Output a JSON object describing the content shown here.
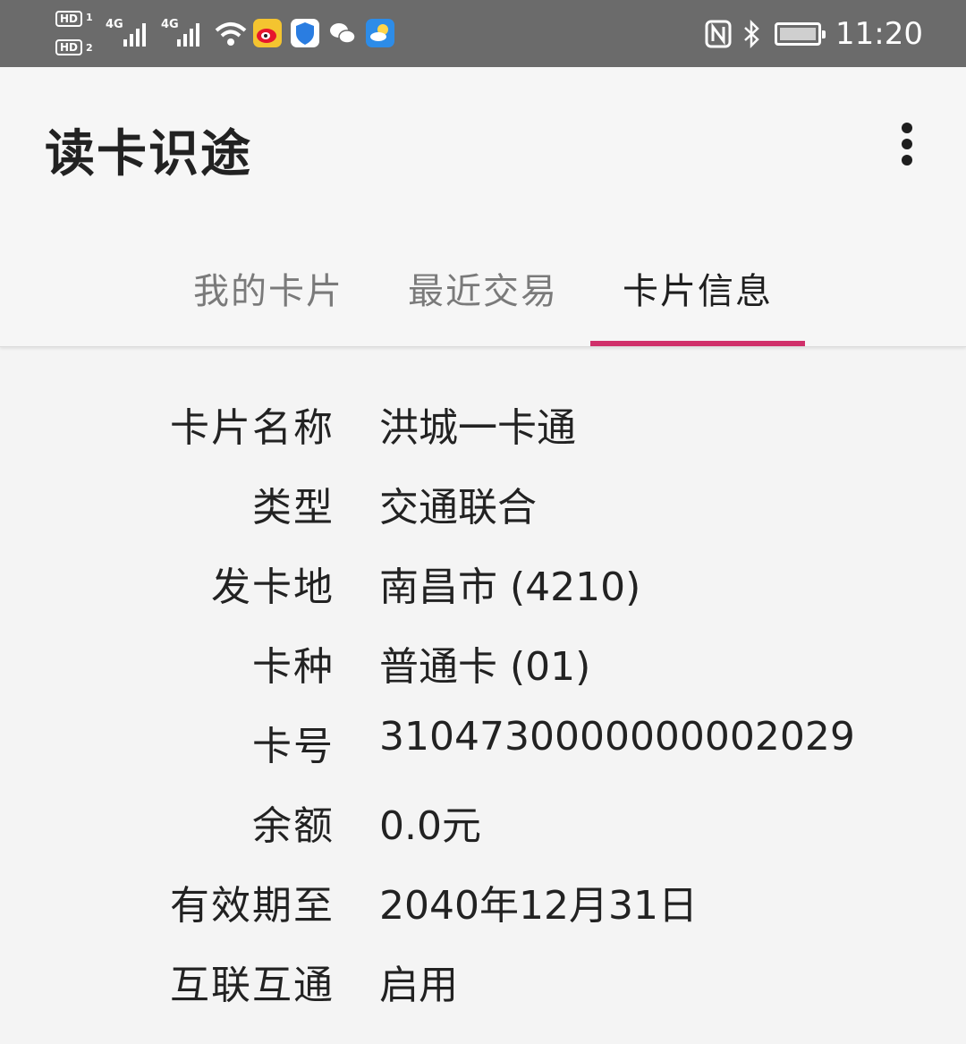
{
  "status_bar": {
    "hd1": "HD",
    "sim1": "1",
    "hd2": "HD",
    "sim2": "2",
    "net1": "4G",
    "net2": "4G",
    "time": "11:20",
    "icons": [
      "hd-icon",
      "signal-icon",
      "wifi-icon",
      "weibo-icon",
      "shield-icon",
      "wechat-icon",
      "weather-icon",
      "nfc-icon",
      "bluetooth-icon",
      "battery-icon"
    ]
  },
  "app_bar": {
    "title": "读卡识途",
    "more_icon": "more-vert-icon"
  },
  "tabs": [
    {
      "label": "我的卡片",
      "active": false
    },
    {
      "label": "最近交易",
      "active": false
    },
    {
      "label": "卡片信息",
      "active": true
    }
  ],
  "accent_color": "#d0306a",
  "card_info": [
    {
      "label": "卡片名称",
      "value": "洪城一卡通"
    },
    {
      "label": "类型",
      "value": "交通联合"
    },
    {
      "label": "发卡地",
      "value": "南昌市 (4210)"
    },
    {
      "label": "卡种",
      "value": "普通卡 (01)"
    },
    {
      "label": "卡号",
      "value": "3104730000000002029"
    },
    {
      "label": "余额",
      "value": "0.0元"
    },
    {
      "label": "有效期至",
      "value": "2040年12月31日"
    },
    {
      "label": "互联互通",
      "value": "启用"
    }
  ]
}
